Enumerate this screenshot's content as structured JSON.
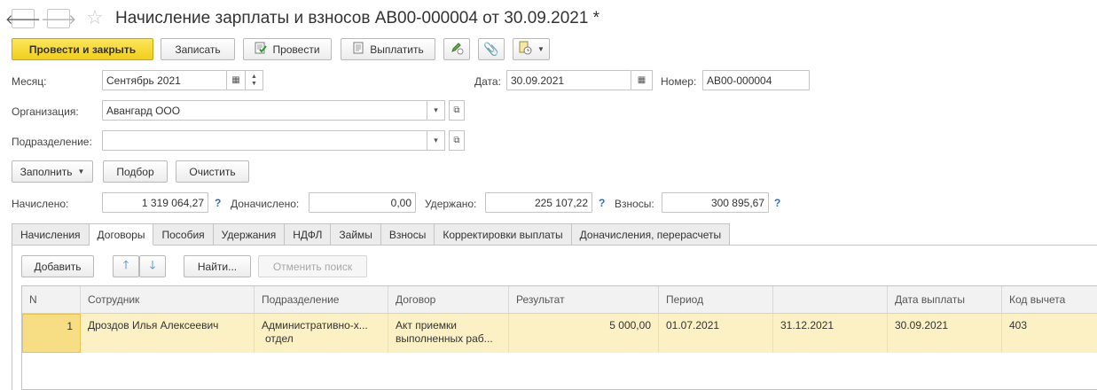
{
  "window": {
    "back_icon": "arrow-left-icon",
    "forward_icon": "arrow-right-icon",
    "favorite_icon": "star-icon",
    "title": "Начисление зарплаты и взносов АВ00-000004 от 30.09.2021 *"
  },
  "toolbar": {
    "post_close": "Провести и закрыть",
    "save": "Записать",
    "post": "Провести",
    "pay": "Выплатить"
  },
  "header": {
    "month_label": "Месяц:",
    "month_value": "Сентябрь 2021",
    "date_label": "Дата:",
    "date_value": "30.09.2021",
    "number_label": "Номер:",
    "number_value": "АВ00-000004",
    "org_label": "Организация:",
    "org_value": "Авангард ООО",
    "dept_label": "Подразделение:",
    "dept_value": ""
  },
  "actions": {
    "fill": "Заполнить",
    "select": "Подбор",
    "clear": "Очистить"
  },
  "totals": {
    "accrued_label": "Начислено:",
    "accrued_value": "1 319 064,27",
    "extra_label": "Доначислено:",
    "extra_value": "0,00",
    "withheld_label": "Удержано:",
    "withheld_value": "225 107,22",
    "contrib_label": "Взносы:",
    "contrib_value": "300 895,67",
    "help": "?"
  },
  "tabs": [
    "Начисления",
    "Договоры",
    "Пособия",
    "Удержания",
    "НДФЛ",
    "Займы",
    "Взносы",
    "Корректировки выплаты",
    "Доначисления, перерасчеты"
  ],
  "active_tab": "Договоры",
  "panel": {
    "add": "Добавить",
    "find": "Найти...",
    "cancel_search": "Отменить поиск"
  },
  "table": {
    "columns": [
      "N",
      "Сотрудник",
      "Подразделение",
      "Договор",
      "Результат",
      "Период",
      "",
      "Дата выплаты",
      "Код вычета"
    ],
    "rows": [
      {
        "n": "1",
        "employee": "Дроздов Илья Алексеевич",
        "dept_line1": "Административно-х...",
        "dept_line2": "отдел",
        "contract_line1": "Акт приемки",
        "contract_line2": "выполненных раб...",
        "result": "5 000,00",
        "period_from": "01.07.2021",
        "period_to": "31.12.2021",
        "pay_date": "30.09.2021",
        "deduction_code": "403"
      }
    ]
  },
  "colors": {
    "primary_button": "#f2cf1c",
    "selected_row": "#fbf1c5",
    "help_link": "#2f6ec0"
  }
}
